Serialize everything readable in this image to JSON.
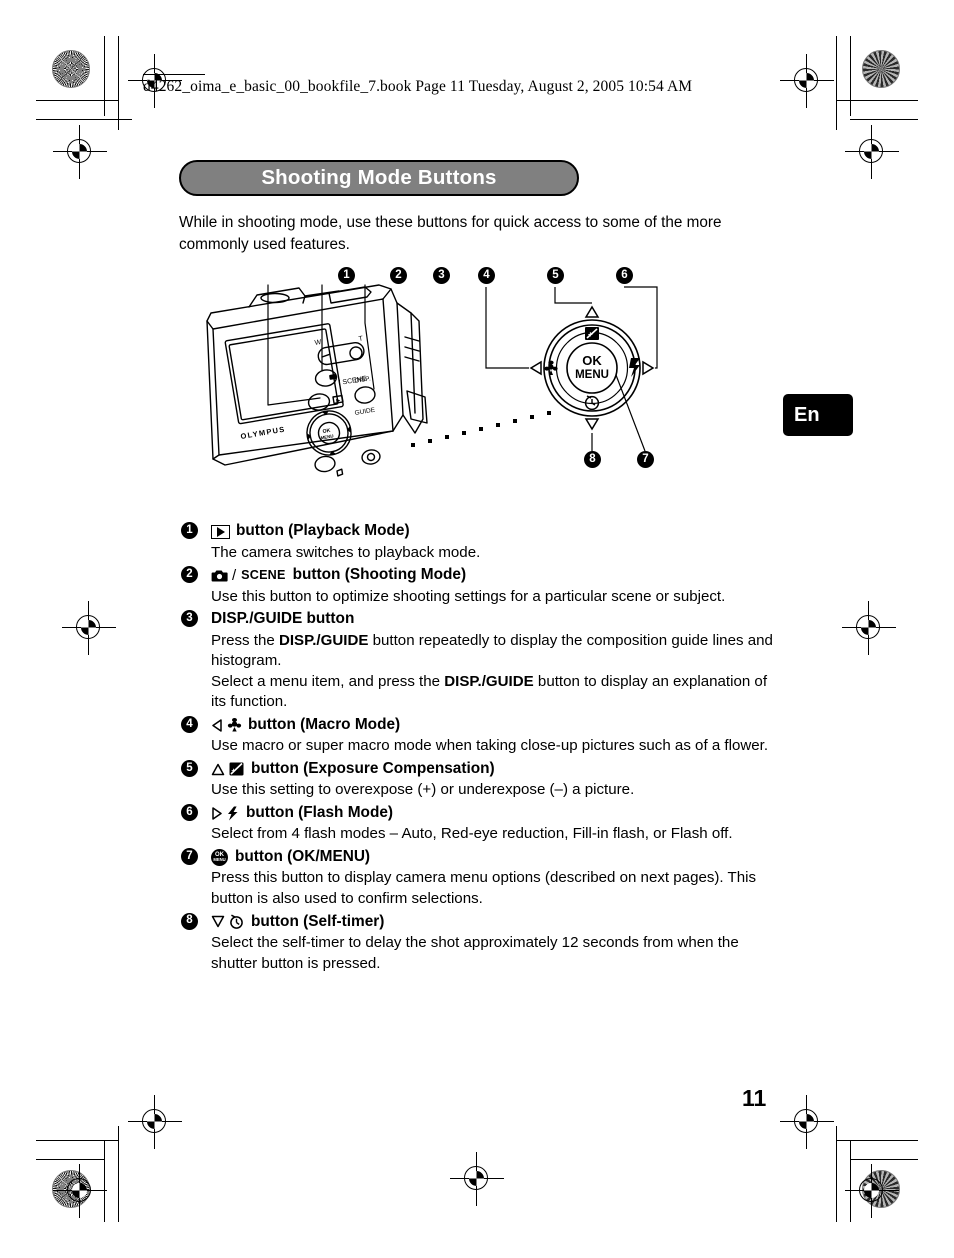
{
  "document": {
    "file_header": "d4262_oima_e_basic_00_bookfile_7.book  Page 11  Tuesday, August 2, 2005  10:54 AM",
    "page_number": "11",
    "language_tab": "En",
    "title": "Shooting Mode Buttons",
    "intro": "While in shooting mode, use these buttons for quick access to some of the more commonly used features."
  },
  "figure": {
    "name": "camera-rear-diagram",
    "brand_label": "OLYMPUS",
    "zoom_wide_label": "W",
    "zoom_tele_label": "T",
    "dial": {
      "center_line1": "OK",
      "center_line2": "MENU",
      "top_icon": "exposure-compensation-icon",
      "left_icon": "macro-flower-icon",
      "right_icon": "flash-bolt-icon",
      "bottom_icon": "self-timer-icon"
    },
    "callouts": [
      "1",
      "2",
      "3",
      "4",
      "5",
      "6",
      "7",
      "8"
    ]
  },
  "items": [
    {
      "num": "1",
      "icon": "playback-icon",
      "head": "button (Playback Mode)",
      "body": "The camera switches to playback mode."
    },
    {
      "num": "2",
      "icon": "camera-icon",
      "scene_label": "SCENE",
      "head": "button (Shooting Mode)",
      "body": "Use this button to optimize shooting settings for a particular scene or subject."
    },
    {
      "num": "3",
      "head": "DISP./GUIDE button",
      "body_1_pre": "Press the ",
      "body_1_bold": "DISP./GUIDE",
      "body_1_post": " button repeatedly to display the composition guide lines and histogram.",
      "body_2_pre": "Select a menu item, and press the ",
      "body_2_bold": "DISP./GUIDE",
      "body_2_post": " button to display an explanation of its function."
    },
    {
      "num": "4",
      "icon": "arrow-left-macro-icon",
      "head": "button (Macro Mode)",
      "body": "Use macro or super macro mode when taking close-up pictures such as of a flower."
    },
    {
      "num": "5",
      "icon": "arrow-up-exposure-icon",
      "head": "button (Exposure Compensation)",
      "body": "Use this setting to overexpose (+) or underexpose (–) a picture."
    },
    {
      "num": "6",
      "icon": "arrow-right-flash-icon",
      "head": "button (Flash Mode)",
      "body": "Select from 4 flash modes – Auto, Red-eye reduction, Fill-in flash, or Flash off."
    },
    {
      "num": "7",
      "icon": "ok-menu-icon",
      "head": "button (OK/MENU)",
      "body": "Press this button to display camera menu options (described on next pages). This button is also used to confirm selections."
    },
    {
      "num": "8",
      "icon": "arrow-down-self-timer-icon",
      "head": "button (Self-timer)",
      "body": "Select the self-timer to delay the shot approximately 12 seconds from when the shutter button is pressed."
    }
  ],
  "colors": {
    "title_bar": "#808080",
    "text": "#000000",
    "tab_bg": "#000000"
  }
}
